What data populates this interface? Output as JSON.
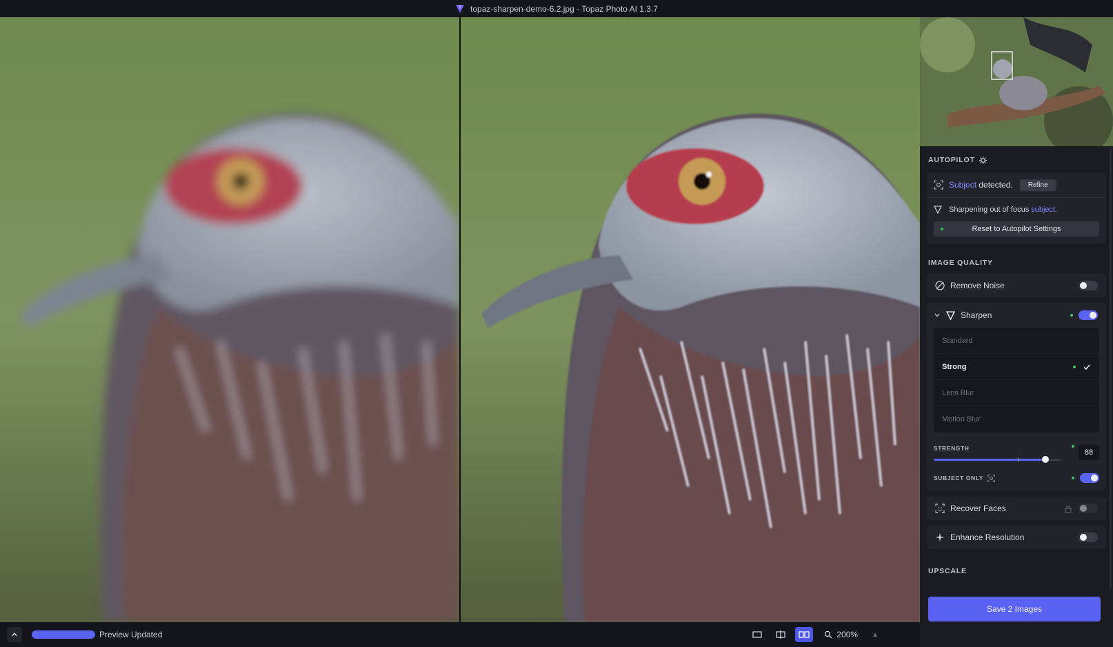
{
  "window": {
    "title": "topaz-sharpen-demo-6.2.jpg - Topaz Photo AI 1.3.7"
  },
  "colors": {
    "accent": "#5b63f5",
    "status_dot": "#4cc26a",
    "panel": "#1b1c22"
  },
  "bottom_bar": {
    "status_text": "Preview Updated",
    "progress": 1.0,
    "zoom_level": "200%",
    "view_modes": [
      "single-view-icon",
      "split-view-icon",
      "side-by-side-icon"
    ],
    "active_view_mode": "side-by-side-icon"
  },
  "autopilot": {
    "title": "AUTOPILOT",
    "subject_link": "Subject",
    "subject_rest": " detected.",
    "refine_label": "Refine",
    "sharpen_text": "Sharpening out of focus ",
    "sharpen_link": "subject.",
    "reset_label": "Reset to Autopilot Settings"
  },
  "image_quality": {
    "title": "IMAGE QUALITY",
    "remove_noise": {
      "label": "Remove Noise",
      "enabled": false
    },
    "sharpen": {
      "label": "Sharpen",
      "enabled": true,
      "modes": [
        "Standard",
        "Strong",
        "Lens Blur",
        "Motion Blur"
      ],
      "selected_mode": "Strong",
      "strength_label": "STRENGTH",
      "strength_value": "88",
      "subject_only_label": "SUBJECT ONLY",
      "subject_only_enabled": true
    },
    "recover_faces": {
      "label": "Recover Faces",
      "enabled": false
    },
    "enhance_resolution": {
      "label": "Enhance Resolution",
      "enabled": false
    }
  },
  "upscale": {
    "title": "UPSCALE"
  },
  "save_label": "Save 2 Images"
}
